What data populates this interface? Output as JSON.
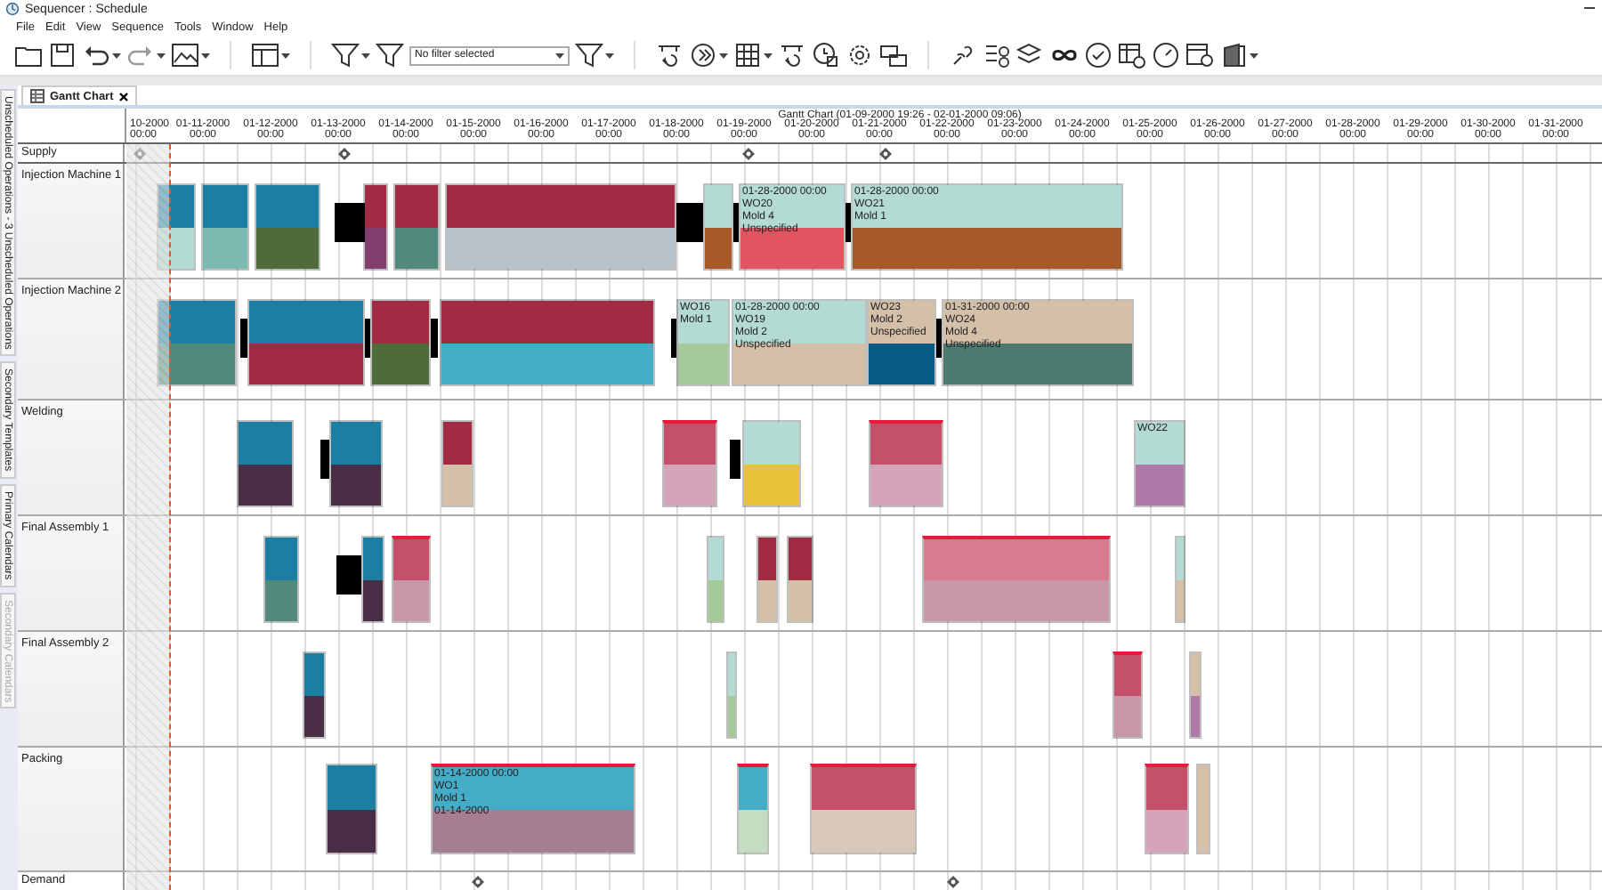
{
  "window": {
    "title": "Sequencer : Schedule"
  },
  "menu": [
    "File",
    "Edit",
    "View",
    "Sequence",
    "Tools",
    "Window",
    "Help"
  ],
  "toolbar": {
    "filter": {
      "value": "No filter selected"
    }
  },
  "side_tabs": [
    {
      "label": "Unscheduled Operations - 3 Unscheduled Operations",
      "disabled": false
    },
    {
      "label": "Secondary Templates",
      "disabled": false
    },
    {
      "label": "Primary Calendars",
      "disabled": false
    },
    {
      "label": "Secondary Calendars",
      "disabled": true
    }
  ],
  "tabs": [
    {
      "label": "Gantt Chart",
      "selected": true
    }
  ],
  "gantt": {
    "title": "Gantt Chart  (01-09-2000 19:26 - 02-01-2000 09:06)",
    "ticks": [
      {
        "date": "10-2000",
        "time": "00:00"
      },
      {
        "date": "01-11-2000",
        "time": "00:00"
      },
      {
        "date": "01-12-2000",
        "time": "00:00"
      },
      {
        "date": "01-13-2000",
        "time": "00:00"
      },
      {
        "date": "01-14-2000",
        "time": "00:00"
      },
      {
        "date": "01-15-2000",
        "time": "00:00"
      },
      {
        "date": "01-16-2000",
        "time": "00:00"
      },
      {
        "date": "01-17-2000",
        "time": "00:00"
      },
      {
        "date": "01-18-2000",
        "time": "00:00"
      },
      {
        "date": "01-19-2000",
        "time": "00:00"
      },
      {
        "date": "01-20-2000",
        "time": "00:00"
      },
      {
        "date": "01-21-2000",
        "time": "00:00"
      },
      {
        "date": "01-22-2000",
        "time": "00:00"
      },
      {
        "date": "01-23-2000",
        "time": "00:00"
      },
      {
        "date": "01-24-2000",
        "time": "00:00"
      },
      {
        "date": "01-25-2000",
        "time": "00:00"
      },
      {
        "date": "01-26-2000",
        "time": "00:00"
      },
      {
        "date": "01-27-2000",
        "time": "00:00"
      },
      {
        "date": "01-28-2000",
        "time": "00:00"
      },
      {
        "date": "01-29-2000",
        "time": "00:00"
      },
      {
        "date": "01-30-2000",
        "time": "00:00"
      },
      {
        "date": "01-31-2000",
        "time": "00:00"
      }
    ],
    "supply": {
      "label": "Supply"
    },
    "resources": [
      {
        "name": "Injection Machine 1",
        "bars": [
          {
            "parts": [
              {
                "color": "#1b7fa3"
              },
              {
                "color": "#b3dbd4"
              }
            ],
            "flagged": false
          },
          {
            "parts": [
              {
                "color": "#1b7fa3"
              },
              {
                "color": "#7cbab1"
              }
            ],
            "flagged": false
          },
          {
            "parts": [
              {
                "color": "#1b7fa3"
              },
              {
                "color": "#4e6b3c"
              }
            ],
            "flagged": false
          },
          {
            "parts": [
              {
                "color": "#a12b43"
              },
              {
                "color": "#7f3e6c"
              }
            ],
            "flagged": false
          },
          {
            "parts": [
              {
                "color": "#a12b43"
              },
              {
                "color": "#4f8a7d"
              }
            ],
            "flagged": false
          },
          {
            "parts": [
              {
                "color": "#a12b43"
              },
              {
                "color": "#b8c2c9"
              }
            ],
            "flagged": false
          },
          {
            "parts": [
              {
                "color": "#b3dbd4"
              },
              {
                "color": "#a65a2a"
              }
            ],
            "flagged": false
          },
          {
            "parts": [
              {
                "color": "#b3dbd4"
              },
              {
                "color": "#e05560"
              }
            ],
            "flagged": false,
            "lines": [
              "01-28-2000 00:00",
              "WO20",
              "Mold 4",
              "Unspecified"
            ]
          },
          {
            "parts": [
              {
                "color": "#b3dbd4"
              },
              {
                "color": "#a65a2a"
              }
            ],
            "flagged": false,
            "lines": [
              "01-28-2000 00:00",
              "WO21",
              "Mold 1"
            ]
          }
        ]
      },
      {
        "name": "Injection Machine 2",
        "bars": [
          {
            "parts": [
              {
                "color": "#1b7fa3"
              },
              {
                "color": "#4f8a7d"
              }
            ],
            "flagged": false
          },
          {
            "parts": [
              {
                "color": "#1b7fa3"
              },
              {
                "color": "#a12b43"
              }
            ],
            "flagged": false
          },
          {
            "parts": [
              {
                "color": "#a12b43"
              },
              {
                "color": "#4e6b3c"
              }
            ],
            "flagged": false
          },
          {
            "parts": [
              {
                "color": "#a12b43"
              },
              {
                "color": "#45acc8"
              }
            ],
            "flagged": false
          },
          {
            "parts": [
              {
                "color": "#b3dbd4"
              },
              {
                "color": "#a6c99a"
              }
            ],
            "flagged": false,
            "lines": [
              "WO16",
              "Mold 1"
            ]
          },
          {
            "parts": [
              {
                "color": "#b3dbd4"
              },
              {
                "color": "#d4bfa8"
              }
            ],
            "flagged": false,
            "lines": [
              "01-28-2000 00:00",
              "WO19",
              "Mold 2",
              "Unspecified"
            ]
          },
          {
            "parts": [
              {
                "color": "#d4bfa8"
              },
              {
                "color": "#0a5a86"
              }
            ],
            "flagged": false,
            "lines": [
              "WO23",
              "Mold 2",
              "Unspecified"
            ]
          },
          {
            "parts": [
              {
                "color": "#d4bfa8"
              },
              {
                "color": "#4d7a6e"
              }
            ],
            "flagged": false,
            "lines": [
              "01-31-2000 00:00",
              "WO24",
              "Mold 4",
              "Unspecified"
            ]
          }
        ]
      },
      {
        "name": "Welding",
        "bars": [
          {
            "parts": [
              {
                "color": "#1b7fa3"
              },
              {
                "color": "#4a2e45"
              }
            ],
            "flagged": false
          },
          {
            "parts": [
              {
                "color": "#1b7fa3"
              },
              {
                "color": "#4a2e45"
              }
            ],
            "flagged": false
          },
          {
            "parts": [
              {
                "color": "#a12b43"
              },
              {
                "color": "#d4bfa8"
              }
            ],
            "flagged": false
          },
          {
            "parts": [
              {
                "color": "#c4506a"
              },
              {
                "color": "#d4a5b8"
              }
            ],
            "flagged": true
          },
          {
            "parts": [
              {
                "color": "#b3dbd4"
              },
              {
                "color": "#e8c03a"
              }
            ],
            "flagged": false
          },
          {
            "parts": [
              {
                "color": "#c4506a"
              },
              {
                "color": "#d4a5b8"
              }
            ],
            "flagged": true
          },
          {
            "parts": [
              {
                "color": "#b3dbd4"
              },
              {
                "color": "#b07aa8"
              }
            ],
            "flagged": false,
            "lines": [
              "WO22"
            ]
          }
        ]
      },
      {
        "name": "Final Assembly 1",
        "bars": [
          {
            "parts": [
              {
                "color": "#1b7fa3"
              },
              {
                "color": "#4f8a7d"
              }
            ],
            "flagged": false
          },
          {
            "parts": [
              {
                "color": "#1b7fa3"
              },
              {
                "color": "#4a2e45"
              }
            ],
            "flagged": false
          },
          {
            "parts": [
              {
                "color": "#c4506a"
              },
              {
                "color": "#c998a8"
              }
            ],
            "flagged": true
          },
          {
            "parts": [
              {
                "color": "#b3dbd4"
              },
              {
                "color": "#a6c99a"
              }
            ],
            "flagged": false
          },
          {
            "parts": [
              {
                "color": "#a12b43"
              },
              {
                "color": "#d4bfa8"
              }
            ],
            "flagged": false
          },
          {
            "parts": [
              {
                "color": "#a12b43"
              },
              {
                "color": "#d4bfa8"
              }
            ],
            "flagged": false
          },
          {
            "parts": [
              {
                "color": "#d87a90"
              },
              {
                "color": "#c998a8"
              }
            ],
            "flagged": true
          },
          {
            "parts": [
              {
                "color": "#b3dbd4"
              },
              {
                "color": "#d4bfa8"
              }
            ],
            "flagged": false
          }
        ]
      },
      {
        "name": "Final Assembly 2",
        "bars": [
          {
            "parts": [
              {
                "color": "#1b7fa3"
              },
              {
                "color": "#4a2e45"
              }
            ],
            "flagged": false
          },
          {
            "parts": [
              {
                "color": "#b3dbd4"
              },
              {
                "color": "#a6c99a"
              }
            ],
            "flagged": false
          },
          {
            "parts": [
              {
                "color": "#c4506a"
              },
              {
                "color": "#c998a8"
              }
            ],
            "flagged": true
          },
          {
            "parts": [
              {
                "color": "#d4bfa8"
              },
              {
                "color": "#b07aa8"
              }
            ],
            "flagged": false
          }
        ]
      },
      {
        "name": "Packing",
        "bars": [
          {
            "parts": [
              {
                "color": "#1b7fa3"
              },
              {
                "color": "#4a2e45"
              }
            ],
            "flagged": false
          },
          {
            "parts": [
              {
                "color": "#45acc8"
              },
              {
                "color": "#a57f8f"
              }
            ],
            "flagged": true,
            "lines": [
              "01-14-2000 00:00",
              "WO1",
              "Mold 1",
              "01-14-2000"
            ]
          },
          {
            "parts": [
              {
                "color": "#45acc8"
              },
              {
                "color": "#c5dcbe"
              }
            ],
            "flagged": true
          },
          {
            "parts": [
              {
                "color": "#c4506a"
              },
              {
                "color": "#d8c8b8"
              }
            ],
            "flagged": true
          },
          {
            "parts": [
              {
                "color": "#c4506a"
              },
              {
                "color": "#d4a5b8"
              }
            ],
            "flagged": true
          },
          {
            "parts": [
              {
                "color": "#d4bfa8"
              },
              {
                "color": "#d4bfa8"
              }
            ],
            "flagged": false
          }
        ]
      }
    ],
    "demand": {
      "label": "Demand"
    }
  }
}
